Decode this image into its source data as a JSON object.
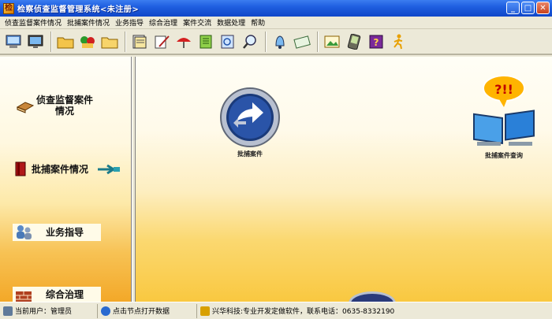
{
  "window": {
    "title": "检察侦查监督管理系统<未注册>",
    "min_symbol": "_",
    "max_symbol": "□",
    "close_symbol": "✕"
  },
  "menu": [
    {
      "label": "侦查监督案件情况"
    },
    {
      "label": "批捕案件情况"
    },
    {
      "label": "业务指导"
    },
    {
      "label": "综合治理"
    },
    {
      "label": "案件交流"
    },
    {
      "label": "数据处理"
    },
    {
      "label": "帮助"
    }
  ],
  "toolbar_icons": [
    "computer-icon",
    "monitor-icon",
    "folder-icon",
    "folder-color-icon",
    "folder-open-icon",
    "document-stack-icon",
    "pen-paper-icon",
    "umbrella-icon",
    "notebook-icon",
    "search-doc-icon",
    "magnifier-icon",
    "bell-icon",
    "envelope-icon",
    "picture-icon",
    "palm-device-icon",
    "help-book-icon",
    "runner-icon"
  ],
  "nav": {
    "items": [
      {
        "label_line1": "侦查监督案件",
        "label_line2": "情况"
      },
      {
        "label": "批捕案件情况"
      },
      {
        "label": "业务指导"
      },
      {
        "label": "综合治理"
      }
    ]
  },
  "desktop": {
    "icons": [
      {
        "label": "批捕案件"
      },
      {
        "label": "批捕案件查询",
        "bubble": "?!!"
      }
    ]
  },
  "status": {
    "user": "当前用户：管理员",
    "hint": "点击节点打开数据",
    "company": "兴华科技:专业开发定做软件，联系电话：0635-8332190"
  }
}
